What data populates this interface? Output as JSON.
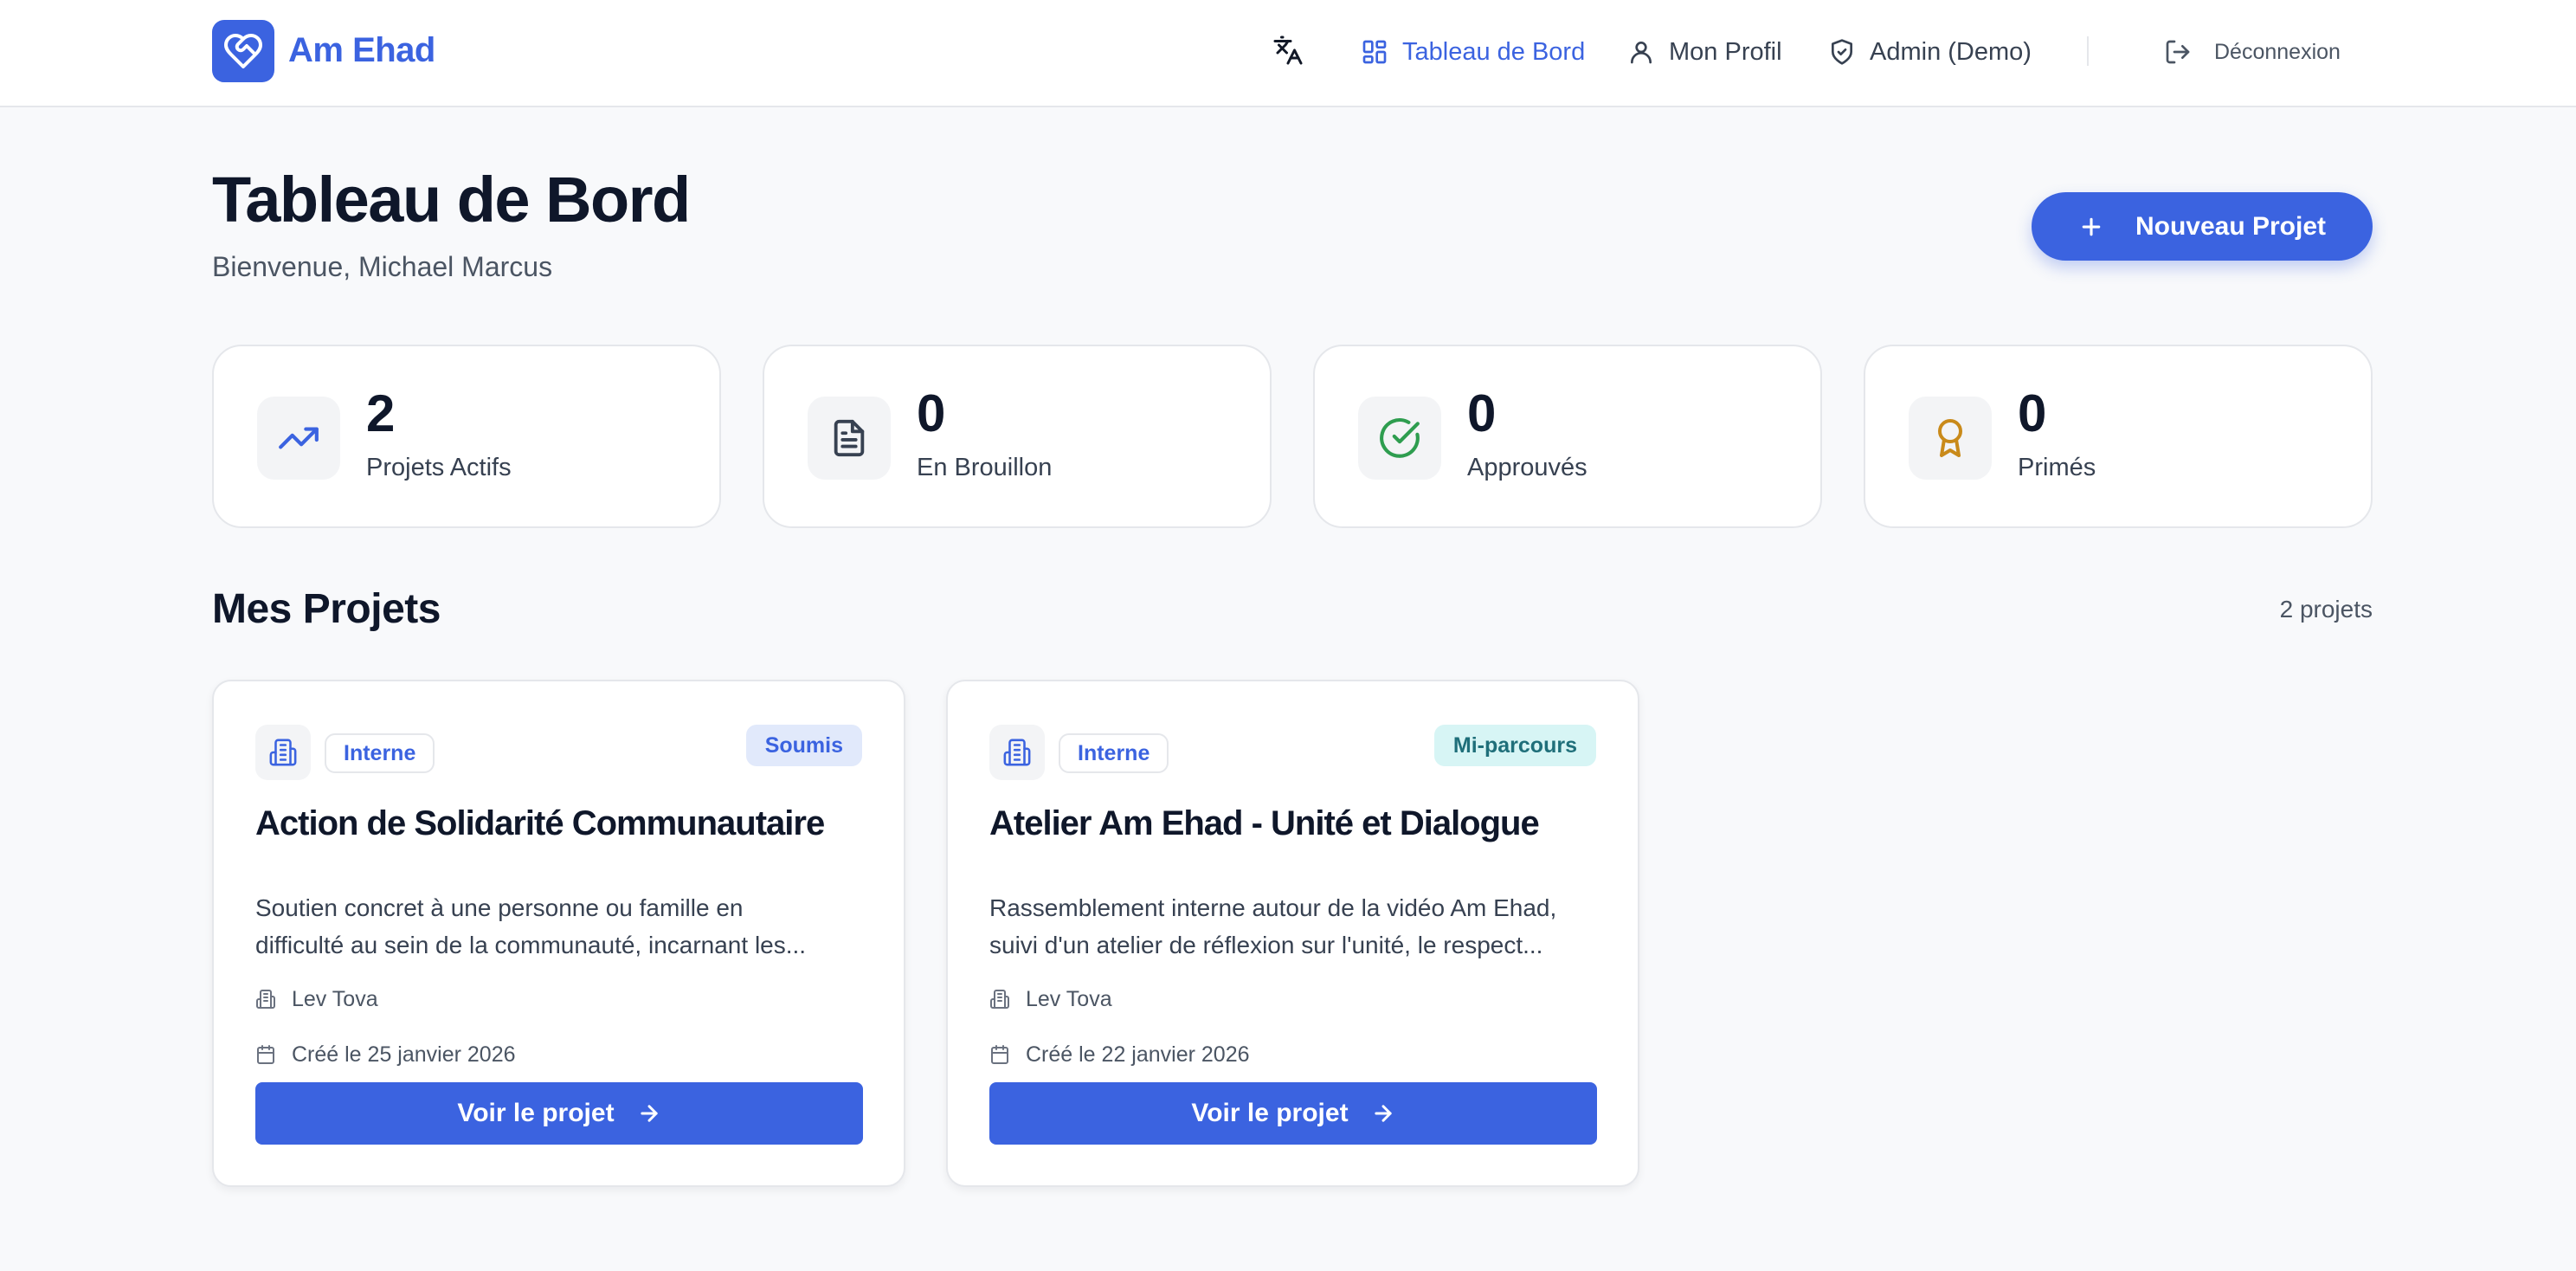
{
  "header": {
    "brand": "Am Ehad",
    "nav": {
      "dashboard": "Tableau de Bord",
      "profile": "Mon Profil",
      "admin": "Admin (Demo)",
      "logout": "Déconnexion"
    },
    "icons": [
      "heart-handshake-icon",
      "translate-icon",
      "dashboard-icon",
      "user-icon",
      "shield-icon",
      "logout-icon"
    ]
  },
  "page": {
    "title": "Tableau de Bord",
    "welcome": "Bienvenue, Michael Marcus",
    "new_project_label": "Nouveau Projet"
  },
  "stats": [
    {
      "value": "2",
      "label": "Projets Actifs",
      "icon": "trending-up-icon",
      "color": "#3b63e0"
    },
    {
      "value": "0",
      "label": "En Brouillon",
      "icon": "document-icon",
      "color": "#374151"
    },
    {
      "value": "0",
      "label": "Approuvés",
      "icon": "check-circle-icon",
      "color": "#2e9d4f"
    },
    {
      "value": "0",
      "label": "Primés",
      "icon": "award-icon",
      "color": "#c98a1a"
    }
  ],
  "projects_section": {
    "title": "Mes Projets",
    "count": "2 projets",
    "items": [
      {
        "type": "Interne",
        "status": "Soumis",
        "title": "Action de Solidarité Communautaire",
        "description_line1": "Soutien concret à une personne ou famille en",
        "description_line2": "difficulté au sein de la communauté, incarnant les...",
        "organization": "Lev Tova",
        "created": "Créé le 25 janvier 2026",
        "button": "Voir le projet"
      },
      {
        "type": "Interne",
        "status": "Mi-parcours",
        "title": "Atelier Am Ehad - Unité et Dialogue",
        "description_line1": "Rassemblement interne autour de la vidéo Am Ehad,",
        "description_line2": "suivi d'un atelier de réflexion sur l'unité, le respect...",
        "organization": "Lev Tova",
        "created": "Créé le 22 janvier 2026",
        "button": "Voir le projet"
      }
    ]
  },
  "colors": {
    "accent": "#3b63e0",
    "background": "#f8f9fb",
    "status_submitted_bg": "#e1e9fb",
    "status_midway_bg": "#d7f5f5"
  }
}
